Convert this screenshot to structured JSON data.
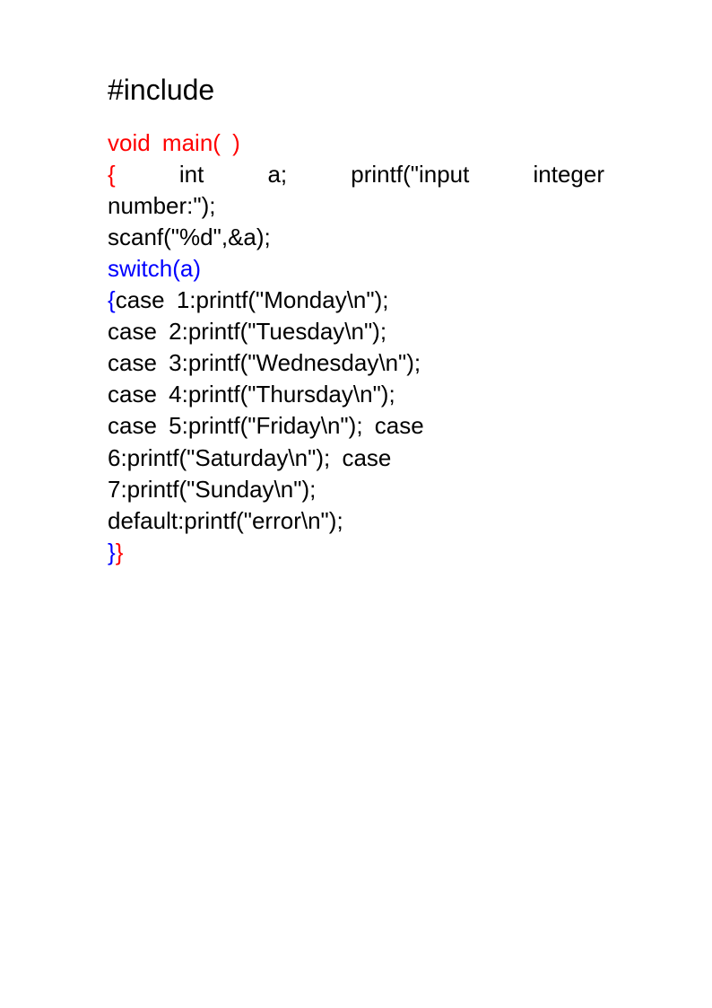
{
  "heading": "#include",
  "code": {
    "l1_voidmain": "void   main",
    "l1_parens": "(   )",
    "l2_brace": "{",
    "l2_rest": " int  a;   printf(\"input   integer",
    "l3": "number:\");",
    "l4": "scanf(\"%d\",&a);",
    "l5_switch": "switch(a)",
    "l6_brace": "{",
    "l6_rest": "case  1:printf(\"Monday\\n\");",
    "l7": "case  2:printf(\"Tuesday\\n\");",
    "l8": "case  3:printf(\"Wednesday\\n\");",
    "l9": "case  4:printf(\"Thursday\\n\");",
    "l10": "case  5:printf(\"Friday\\n\");  case",
    "l11": "6:printf(\"Saturday\\n\");  case",
    "l12": "7:printf(\"Sunday\\n\");",
    "l13": "default:printf(\"error\\n\");",
    "l14_b1": "}",
    "l14_b2": "}"
  }
}
